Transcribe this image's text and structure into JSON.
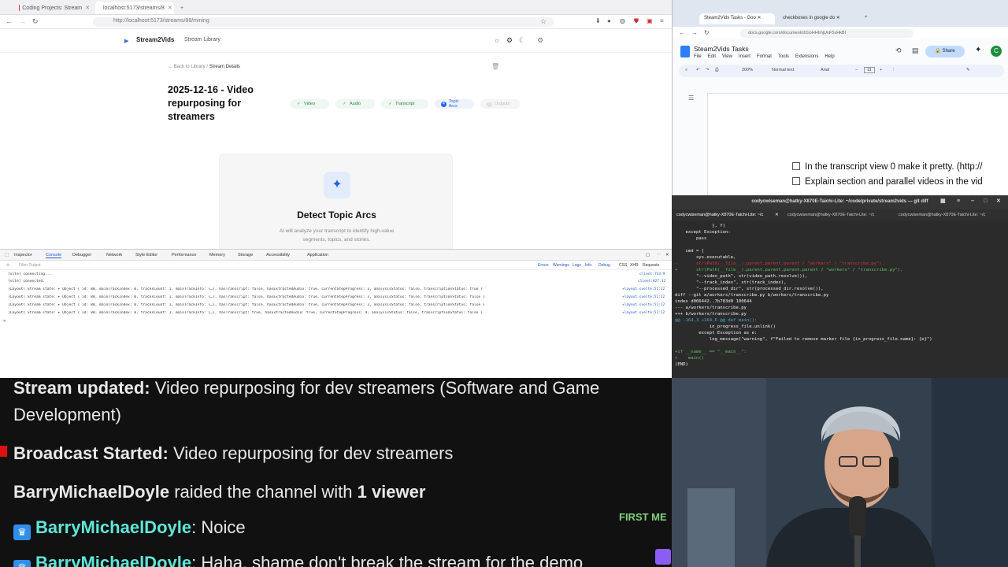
{
  "left_browser": {
    "tabs": [
      {
        "label": "Coding Projects: Stream"
      },
      {
        "label": "localhost:5173/streams/8"
      }
    ],
    "url": "http://localhost:5173/streams/88/mining",
    "app": {
      "brand": "Stream2Vids",
      "nav_library": "Stream Library",
      "back_link": "← Back to Library",
      "crumb_current": "Stream Details",
      "title": "2025-12-16 - Video repurposing for streamers",
      "steps": [
        {
          "label": "Video",
          "state": "done"
        },
        {
          "label": "Audio",
          "state": "done"
        },
        {
          "label": "Transcript",
          "state": "done"
        },
        {
          "label": "Topic Arcs",
          "state": "current"
        },
        {
          "label": "Outputs",
          "state": "disabled"
        }
      ],
      "card": {
        "title": "Detect Topic Arcs",
        "description": "AI will analyze your transcript to identify high-value segments, topics, and stories."
      }
    },
    "devtools": {
      "tabs": [
        "Inspector",
        "Console",
        "Debugger",
        "Network",
        "Style Editor",
        "Performance",
        "Memory",
        "Storage",
        "Accessibility",
        "Application"
      ],
      "filter_placeholder": "Filter Output",
      "filters": [
        "Errors",
        "Warnings",
        "Logs",
        "Info",
        "Debug",
        "CSS",
        "XHR",
        "Requests"
      ],
      "logs": [
        {
          "text": "[vite] connecting...",
          "src": "client:733:9"
        },
        {
          "text": "[vite] connected.",
          "src": "client:827:12"
        },
        {
          "text": "[Layout] Stream state: ▸ Object { id: 88, mainTrackIndex: 0, tracksCount: 1, mainTrackInfo: {…}, hasTranscript: false, hasExtractedAudio: true, currentStepProgress: 3, analysisStatus: false, transcriptionStatus: true }",
          "src": "+layout.svelte:51:12"
        },
        {
          "text": "[Layout] Stream state: ▸ Object { id: 88, mainTrackIndex: 0, tracksCount: 1, mainTrackInfo: {…}, hasTranscript: false, hasExtractedAudio: true, currentStepProgress: 3, analysisStatus: false, transcriptionStatus: false }",
          "src": "+layout.svelte:51:12"
        },
        {
          "text": "[Layout] Stream state: ▸ Object { id: 88, mainTrackIndex: 0, tracksCount: 1, mainTrackInfo: {…}, hasTranscript: false, hasExtractedAudio: true, currentStepProgress: 3, analysisStatus: false, transcriptionStatus: false }",
          "src": "+layout.svelte:51:12"
        },
        {
          "text": "[Layout] Stream state: ▸ Object { id: 88, mainTrackIndex: 0, tracksCount: 1, mainTrackInfo: {…}, hasTranscript: true, hasExtractedAudio: true, currentStepProgress: 4, analysisStatus: false, transcriptionStatus: false }",
          "src": "+layout.svelte:51:12"
        }
      ]
    }
  },
  "docs": {
    "tabs": [
      {
        "label": "Steam2Vids Tasks - Goo"
      },
      {
        "label": "checkboxes in google do"
      }
    ],
    "url": "docs.google.com/document/d/1ioHHImjUnF5xHkBl",
    "doc_name": "Steam2Vids Tasks",
    "menus": [
      "File",
      "Edit",
      "View",
      "Insert",
      "Format",
      "Tools",
      "Extensions",
      "Help"
    ],
    "share": "Share",
    "avatar": "C",
    "zoom": "200%",
    "style": "Normal text",
    "font": "Arial",
    "font_size": "11",
    "checklist": [
      "In the transcript view 0 make it pretty. (http://",
      "Explain section and parallel videos in the vid"
    ]
  },
  "terminal": {
    "title": "codycwiseman@hatky-X870E-Taichi-Lite: ~/code/private/stream2vids — git diff",
    "subtitle": "~/code/private/stream2vids",
    "tabs": [
      "codycwiseman@hatky-X870E-Taichi-Lite: ~/c",
      "codycwiseman@hatky-X870E-Taichi-Lite: ~/c",
      "codycwiseman@hatky-X870E-Taichi-Lite: ~/c"
    ],
    "lines": [
      {
        "t": "              }, f)",
        "c": "w"
      },
      {
        "t": "    except Exception:",
        "c": "w"
      },
      {
        "t": "        pass",
        "c": "w"
      },
      {
        "t": "",
        "c": "w"
      },
      {
        "t": "    cmd = [",
        "c": "w"
      },
      {
        "t": "        sys.executable,",
        "c": "w"
      },
      {
        "t": "-       str(Path(__file__).parent.parent.parent / \"workers\" / \"transcribe.py\"),",
        "c": "r"
      },
      {
        "t": "+       str(Path(__file__).parent.parent.parent.parent / \"workers\" / \"transcribe.py\"),",
        "c": "g"
      },
      {
        "t": "        \"--video_path\", str(video_path.resolve()),",
        "c": "w"
      },
      {
        "t": "        \"--track_index\", str(track_index),",
        "c": "w"
      },
      {
        "t": "        \"--processed_dir\", str(processed_dir.resolve()),",
        "c": "w"
      },
      {
        "t": "diff --git a/workers/transcribe.py b/workers/transcribe.py",
        "c": "w"
      },
      {
        "t": "index d066442..7b783d0 100644",
        "c": "w"
      },
      {
        "t": "--- a/workers/transcribe.py",
        "c": "w"
      },
      {
        "t": "+++ b/workers/transcribe.py",
        "c": "w"
      },
      {
        "t": "@@ -164,3 +164,6 @@ def main():",
        "c": "c"
      },
      {
        "t": "             in_progress_file.unlink()",
        "c": "w"
      },
      {
        "t": "         except Exception as e:",
        "c": "w"
      },
      {
        "t": "             log_message(\"warning\", f\"Failed to remove marker file {in_progress_file.name}: {e}\")",
        "c": "w"
      },
      {
        "t": "",
        "c": "w"
      },
      {
        "t": "+if __name__ == \"__main__\":",
        "c": "g"
      },
      {
        "t": "+    main()",
        "c": "g"
      },
      {
        "t": "(END)",
        "c": "w"
      }
    ]
  },
  "chat": {
    "messages": [
      {
        "bold": "Stream updated:",
        "text": " Video repurposing for dev streamers (Software and Game",
        "cont": "Development)"
      },
      {
        "bold": "Broadcast Started:",
        "text": " Video repurposing for dev streamers"
      },
      {
        "bold": "BarryMichaelDoyle",
        "text": " raided the channel with ",
        "bold2": "1 viewer"
      },
      {
        "user": "BarryMichaelDoyle",
        "text": " Noice"
      },
      {
        "user": "BarryMichaelDoyle",
        "text": " Haha, shame don't break the stream for the demo"
      }
    ],
    "first_badge": "FIRST ME"
  },
  "colors": {
    "accent": "#2563eb",
    "done": "#2a7d4b",
    "chat_user": "#5fe6d8",
    "terminal_bg": "#2b2b2b"
  }
}
